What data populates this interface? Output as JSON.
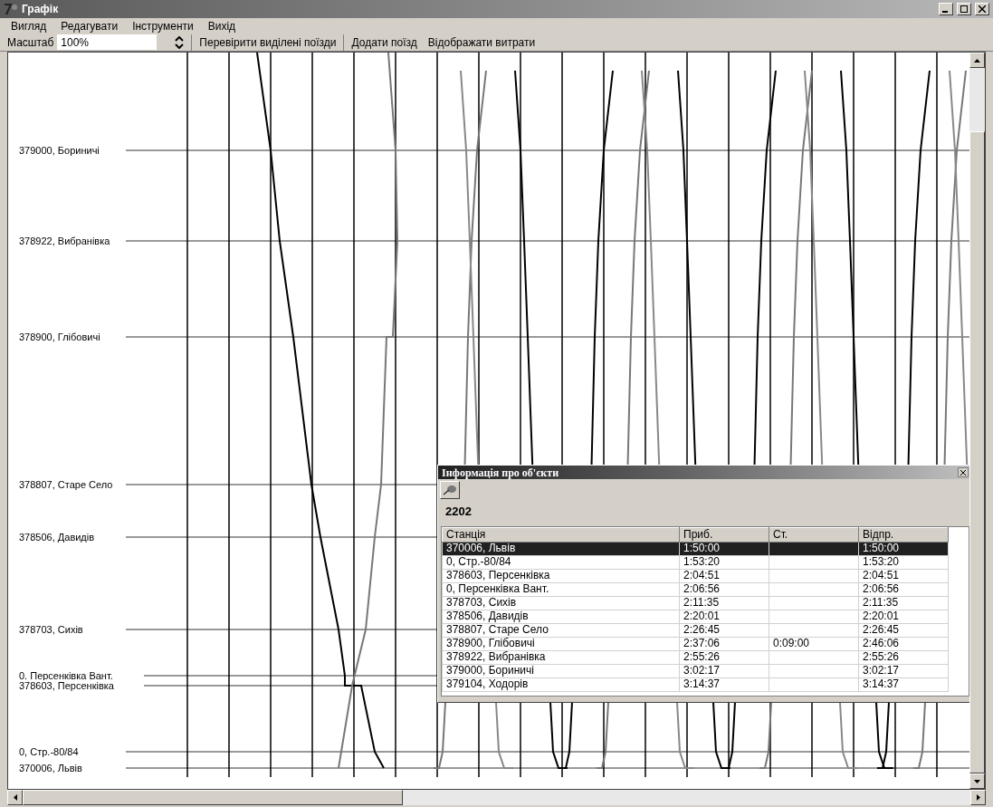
{
  "window": {
    "title": "Графік"
  },
  "menu": [
    "Вигляд",
    "Редагувати",
    "Інструменти",
    "Вихід"
  ],
  "toolbar": {
    "scale_label": "Масштаб",
    "scale_value": "100%",
    "buttons": [
      "Перевірити виділені поїзди",
      "Додати поїзд",
      "Відображати витрати"
    ]
  },
  "stations": [
    "379000, Бориничі",
    "378922, Вибранівка",
    "378900, Глібовичі",
    "378807, Старе Село",
    "378506, Давидів",
    "378703, Сихів",
    "0. Персенківка Вант.",
    "378603, Персенківка",
    "0, Стр.-80/84",
    "370006, Львів"
  ],
  "info_window": {
    "title": "Інформація про об'єкти",
    "train": "2202",
    "columns": [
      "Станція",
      "Приб.",
      "Ст.",
      "Відпр."
    ],
    "rows": [
      {
        "cells": [
          "370006, Львів",
          "1:50:00",
          "",
          "1:50:00"
        ],
        "selected": true
      },
      {
        "cells": [
          "0, Стр.-80/84",
          "1:53:20",
          "",
          "1:53:20"
        ],
        "selected": false
      },
      {
        "cells": [
          "378603, Персенківка",
          "2:04:51",
          "",
          "2:04:51"
        ],
        "selected": false
      },
      {
        "cells": [
          "0, Персенківка Вант.",
          "2:06:56",
          "",
          "2:06:56"
        ],
        "selected": false
      },
      {
        "cells": [
          "378703, Сихів",
          "2:11:35",
          "",
          "2:11:35"
        ],
        "selected": false
      },
      {
        "cells": [
          "378506, Давидів",
          "2:20:01",
          "",
          "2:20:01"
        ],
        "selected": false
      },
      {
        "cells": [
          "378807, Старе Село",
          "2:26:45",
          "",
          "2:26:45"
        ],
        "selected": false
      },
      {
        "cells": [
          "378900, Глібовичі",
          "2:37:06",
          "0:09:00",
          "2:46:06"
        ],
        "selected": false
      },
      {
        "cells": [
          "378922, Вибранівка",
          "2:55:26",
          "",
          "2:55:26"
        ],
        "selected": false
      },
      {
        "cells": [
          "379000, Бориничі",
          "3:02:17",
          "",
          "3:02:17"
        ],
        "selected": false
      },
      {
        "cells": [
          "379104, Ходорів",
          "3:14:37",
          "",
          "3:14:37"
        ],
        "selected": false
      }
    ]
  }
}
